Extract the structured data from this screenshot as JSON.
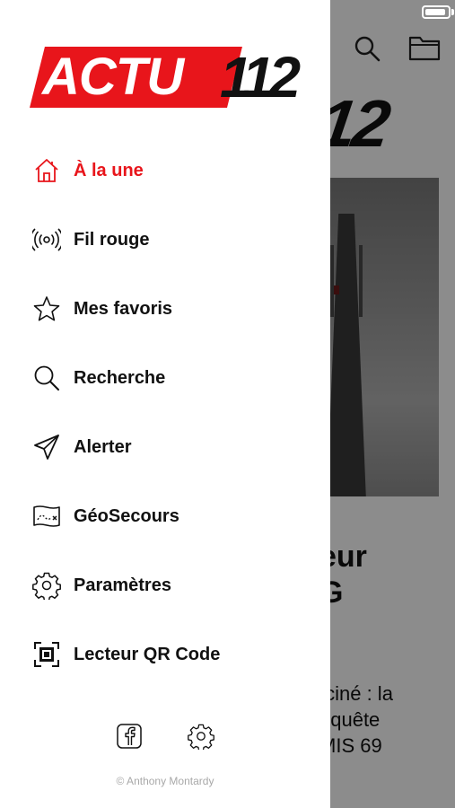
{
  "background": {
    "logo_tail": "12",
    "headline": "eur\nG",
    "excerpt": " ciné : la\nequête\nMIS 69"
  },
  "drawer": {
    "logo": {
      "red_text": "ACTU",
      "number": "112"
    },
    "menu": [
      {
        "label": "À la une",
        "icon": "home-icon",
        "active": true
      },
      {
        "label": "Fil rouge",
        "icon": "broadcast-icon",
        "active": false
      },
      {
        "label": "Mes favoris",
        "icon": "star-icon",
        "active": false
      },
      {
        "label": "Recherche",
        "icon": "search-icon",
        "active": false
      },
      {
        "label": "Alerter",
        "icon": "send-icon",
        "active": false
      },
      {
        "label": "GéoSecours",
        "icon": "map-icon",
        "active": false
      },
      {
        "label": "Paramètres",
        "icon": "gear-icon",
        "active": false
      },
      {
        "label": "Lecteur QR Code",
        "icon": "qr-scan-icon",
        "active": false
      }
    ],
    "footer": {
      "copyright": "© Anthony Montardy"
    }
  },
  "colors": {
    "accent": "#e8151b",
    "text": "#111111",
    "muted": "#a8a8a8",
    "overlay": "rgba(0,0,0,0.45)"
  }
}
